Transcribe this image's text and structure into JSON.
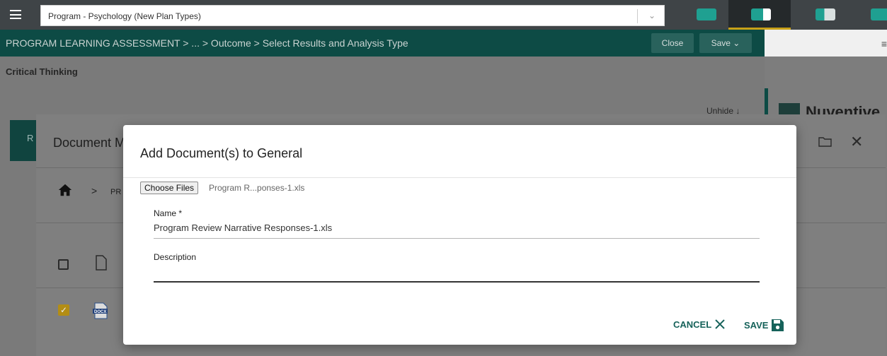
{
  "topbar": {
    "program_select": "Program - Psychology (New Plan Types)"
  },
  "breadcrumb": {
    "text": "PROGRAM LEARNING ASSESSMENT > ... > Outcome > Select Results and Analysis Type",
    "close_label": "Close",
    "save_label": "Save ⌄"
  },
  "section": {
    "title": "Critical Thinking",
    "unhide_label": "Unhide ↓",
    "side_letter": "R"
  },
  "right_panel": {
    "logo_text": "Nuventive"
  },
  "document_dialog": {
    "title": "Document M",
    "breadcrumb_partial": "PR"
  },
  "modal": {
    "title": "Add Document(s) to General",
    "choose_files_label": "Choose Files",
    "chosen_file": "Program R...ponses-1.xls",
    "name_label": "Name *",
    "name_value": "Program Review Narrative Responses-1.xls",
    "description_label": "Description",
    "description_value": "",
    "cancel_label": "CANCEL",
    "save_label": "SAVE"
  },
  "colors": {
    "teal_dark": "#0d4b45",
    "accent_teal": "#1fa091",
    "action_text": "#16625a",
    "checkbox_gold": "#b38d14"
  }
}
